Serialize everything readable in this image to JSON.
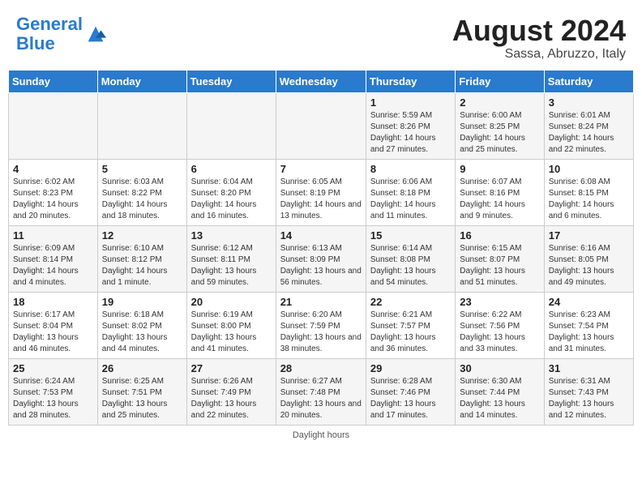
{
  "header": {
    "logo_line1": "General",
    "logo_line2": "Blue",
    "month_year": "August 2024",
    "location": "Sassa, Abruzzo, Italy"
  },
  "columns": [
    "Sunday",
    "Monday",
    "Tuesday",
    "Wednesday",
    "Thursday",
    "Friday",
    "Saturday"
  ],
  "weeks": [
    [
      {
        "num": "",
        "info": ""
      },
      {
        "num": "",
        "info": ""
      },
      {
        "num": "",
        "info": ""
      },
      {
        "num": "",
        "info": ""
      },
      {
        "num": "1",
        "info": "Sunrise: 5:59 AM\nSunset: 8:26 PM\nDaylight: 14 hours and 27 minutes."
      },
      {
        "num": "2",
        "info": "Sunrise: 6:00 AM\nSunset: 8:25 PM\nDaylight: 14 hours and 25 minutes."
      },
      {
        "num": "3",
        "info": "Sunrise: 6:01 AM\nSunset: 8:24 PM\nDaylight: 14 hours and 22 minutes."
      }
    ],
    [
      {
        "num": "4",
        "info": "Sunrise: 6:02 AM\nSunset: 8:23 PM\nDaylight: 14 hours and 20 minutes."
      },
      {
        "num": "5",
        "info": "Sunrise: 6:03 AM\nSunset: 8:22 PM\nDaylight: 14 hours and 18 minutes."
      },
      {
        "num": "6",
        "info": "Sunrise: 6:04 AM\nSunset: 8:20 PM\nDaylight: 14 hours and 16 minutes."
      },
      {
        "num": "7",
        "info": "Sunrise: 6:05 AM\nSunset: 8:19 PM\nDaylight: 14 hours and 13 minutes."
      },
      {
        "num": "8",
        "info": "Sunrise: 6:06 AM\nSunset: 8:18 PM\nDaylight: 14 hours and 11 minutes."
      },
      {
        "num": "9",
        "info": "Sunrise: 6:07 AM\nSunset: 8:16 PM\nDaylight: 14 hours and 9 minutes."
      },
      {
        "num": "10",
        "info": "Sunrise: 6:08 AM\nSunset: 8:15 PM\nDaylight: 14 hours and 6 minutes."
      }
    ],
    [
      {
        "num": "11",
        "info": "Sunrise: 6:09 AM\nSunset: 8:14 PM\nDaylight: 14 hours and 4 minutes."
      },
      {
        "num": "12",
        "info": "Sunrise: 6:10 AM\nSunset: 8:12 PM\nDaylight: 14 hours and 1 minute."
      },
      {
        "num": "13",
        "info": "Sunrise: 6:12 AM\nSunset: 8:11 PM\nDaylight: 13 hours and 59 minutes."
      },
      {
        "num": "14",
        "info": "Sunrise: 6:13 AM\nSunset: 8:09 PM\nDaylight: 13 hours and 56 minutes."
      },
      {
        "num": "15",
        "info": "Sunrise: 6:14 AM\nSunset: 8:08 PM\nDaylight: 13 hours and 54 minutes."
      },
      {
        "num": "16",
        "info": "Sunrise: 6:15 AM\nSunset: 8:07 PM\nDaylight: 13 hours and 51 minutes."
      },
      {
        "num": "17",
        "info": "Sunrise: 6:16 AM\nSunset: 8:05 PM\nDaylight: 13 hours and 49 minutes."
      }
    ],
    [
      {
        "num": "18",
        "info": "Sunrise: 6:17 AM\nSunset: 8:04 PM\nDaylight: 13 hours and 46 minutes."
      },
      {
        "num": "19",
        "info": "Sunrise: 6:18 AM\nSunset: 8:02 PM\nDaylight: 13 hours and 44 minutes."
      },
      {
        "num": "20",
        "info": "Sunrise: 6:19 AM\nSunset: 8:00 PM\nDaylight: 13 hours and 41 minutes."
      },
      {
        "num": "21",
        "info": "Sunrise: 6:20 AM\nSunset: 7:59 PM\nDaylight: 13 hours and 38 minutes."
      },
      {
        "num": "22",
        "info": "Sunrise: 6:21 AM\nSunset: 7:57 PM\nDaylight: 13 hours and 36 minutes."
      },
      {
        "num": "23",
        "info": "Sunrise: 6:22 AM\nSunset: 7:56 PM\nDaylight: 13 hours and 33 minutes."
      },
      {
        "num": "24",
        "info": "Sunrise: 6:23 AM\nSunset: 7:54 PM\nDaylight: 13 hours and 31 minutes."
      }
    ],
    [
      {
        "num": "25",
        "info": "Sunrise: 6:24 AM\nSunset: 7:53 PM\nDaylight: 13 hours and 28 minutes."
      },
      {
        "num": "26",
        "info": "Sunrise: 6:25 AM\nSunset: 7:51 PM\nDaylight: 13 hours and 25 minutes."
      },
      {
        "num": "27",
        "info": "Sunrise: 6:26 AM\nSunset: 7:49 PM\nDaylight: 13 hours and 22 minutes."
      },
      {
        "num": "28",
        "info": "Sunrise: 6:27 AM\nSunset: 7:48 PM\nDaylight: 13 hours and 20 minutes."
      },
      {
        "num": "29",
        "info": "Sunrise: 6:28 AM\nSunset: 7:46 PM\nDaylight: 13 hours and 17 minutes."
      },
      {
        "num": "30",
        "info": "Sunrise: 6:30 AM\nSunset: 7:44 PM\nDaylight: 13 hours and 14 minutes."
      },
      {
        "num": "31",
        "info": "Sunrise: 6:31 AM\nSunset: 7:43 PM\nDaylight: 13 hours and 12 minutes."
      }
    ]
  ],
  "footer": {
    "note": "Daylight hours"
  }
}
